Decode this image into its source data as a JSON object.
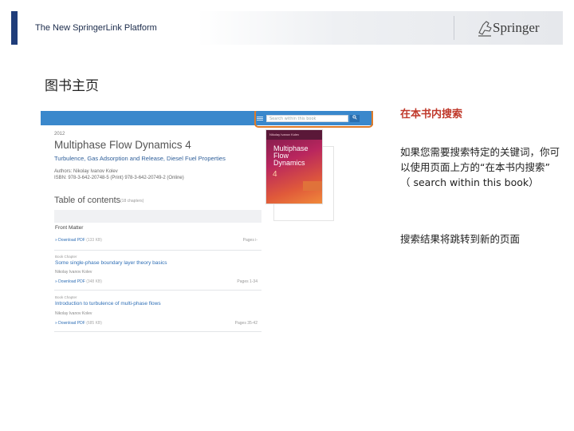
{
  "header": {
    "title": "The New SpringerLink Platform",
    "logo_text": "Springer"
  },
  "slide": {
    "title": "图书主页"
  },
  "screenshot": {
    "search_placeholder": "Search within this book",
    "year": "2012",
    "book_title": "Multiphase Flow Dynamics 4",
    "book_subtitle": "Turbulence, Gas Adsorption and Release, Diesel Fuel Properties",
    "authors": "Authors: Nikolay Ivanov Kolev",
    "isbn": "ISBN: 978-3-642-20748-5 (Print) 978-3-642-20749-2 (Online)",
    "toc_heading": "Table of contents",
    "toc_sub": "(18 chapters)",
    "cover": {
      "author": "Nikolay Ivanov Kolev",
      "t1": "Multiphase",
      "t2": "Flow",
      "t3": "Dynamics",
      "num": "4"
    },
    "items": [
      {
        "kicker": "",
        "title": "Front Matter",
        "author": "",
        "download": "Download PDF",
        "size": "(133 KB)",
        "pages": "Pages i-"
      },
      {
        "kicker": "Book Chapter",
        "title": "Some single-phase boundary layer theory basics",
        "author": "Nikolay Ivanov Kolev",
        "download": "Download PDF",
        "size": "(348 KB)",
        "pages": "Pages 1-34"
      },
      {
        "kicker": "Book Chapter",
        "title": "Introduction to turbulence of multi-phase flows",
        "author": "Nikolay Ivanov Kolev",
        "download": "Download PDF",
        "size": "(685 KB)",
        "pages": "Pages 35-42"
      }
    ]
  },
  "right_text": {
    "heading": "在本书内搜索",
    "p1": "如果您需要搜索特定的关键词，你可以使用页面上方的“在本书内搜索” （ search within this book）",
    "p2": "搜索结果将跳转到新的页面"
  },
  "colors": {
    "accent_bar": "#1f3d7a",
    "highlight": "#e07b28",
    "heading_red": "#c0392b",
    "link_blue": "#2f6fb6"
  }
}
